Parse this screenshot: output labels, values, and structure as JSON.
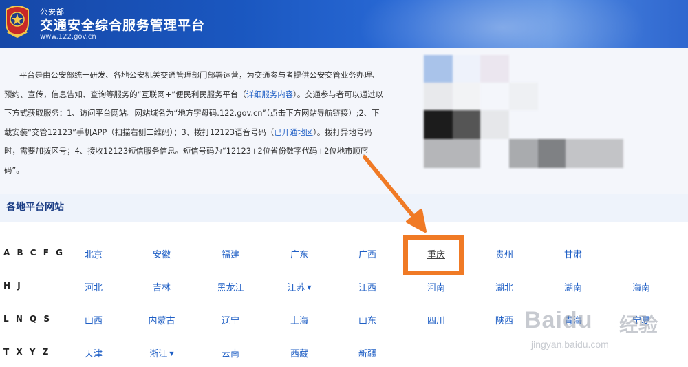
{
  "header": {
    "org": "公安部",
    "title": "交通安全综合服务管理平台",
    "url": "www.122.gov.cn"
  },
  "intro": {
    "p1": "平台是由公安部统一研发、各地公安机关交通管理部门部署运营，为交通参与者提供公安交管业务办理、预约、宣传，信息告知、查询等服务的“互联网+”便民利民服务平台（",
    "link_services": "详细服务内容",
    "p2": "）。交通参与者可以通过以下方式获取服务：1、访问平台网站。网站域名为“地方字母码.122.gov.cn”（点击下方网站导航链接）;2、下载安装“交管12123”手机APP（扫描右侧二维码）；3、拨打12123语音号码（",
    "link_regions": "已开通地区",
    "p3": "）。拨打异地号码时，需要加拨区号；4、接收12123短信服务信息。短信号码为“12123+2位省份数字代码+2位地市顺序码”。"
  },
  "section": {
    "title": "各地平台网站"
  },
  "rows": [
    {
      "label": "A B C F G",
      "cities": [
        "北京",
        "安徽",
        "福建",
        "广东",
        "广西",
        "重庆",
        "贵州",
        "甘肃"
      ]
    },
    {
      "label": "H J",
      "cities": [
        "河北",
        "吉林",
        "黑龙江",
        "江苏",
        "江西",
        "河南",
        "湖北",
        "湖南",
        "海南"
      ]
    },
    {
      "label": "L N Q S",
      "cities": [
        "山西",
        "内蒙古",
        "辽宁",
        "上海",
        "山东",
        "四川",
        "陕西",
        "青海",
        "宁夏"
      ]
    },
    {
      "label": "T X Y Z",
      "cities": [
        "天津",
        "浙江",
        "云南",
        "西藏",
        "新疆"
      ]
    }
  ],
  "dropdown_caret": "▼",
  "annotation": {
    "color": "#f07a25",
    "highlighted_city": "重庆"
  },
  "watermark": {
    "brand": "Bai",
    "paw": "du",
    "cn": "经验",
    "url": "jingyan.baidu.com"
  },
  "colors": {
    "header": "#1a57c0",
    "link": "#1f5fc5",
    "accent": "#f07a25"
  }
}
